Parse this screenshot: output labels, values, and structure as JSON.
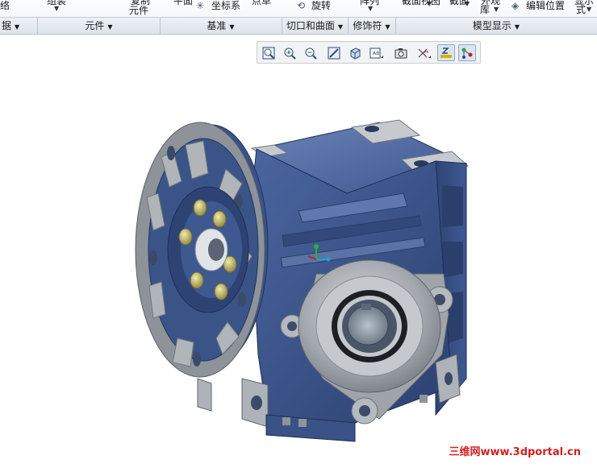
{
  "ribbon": {
    "cut_labels": [
      "组合",
      "组装",
      "元件",
      "平面",
      "坐标系",
      "基准",
      "旋转",
      "阵列",
      "截面视图",
      "截面",
      "库",
      "编辑位置",
      "显示样式"
    ],
    "partial": {
      "p0": "",
      "p1": "",
      "p2": "元件",
      "p3": "坐标系",
      "p4": "",
      "p5": "旋转",
      "p6": "",
      "p7": "库",
      "p8": "编辑位置",
      "p9": "式"
    },
    "groups": {
      "data": "据",
      "component": "元件",
      "datum": "基准",
      "cut_surface": "切口和曲面",
      "modifiers": "修饰符",
      "model_display": "模型显示"
    }
  },
  "view_toolbar": {
    "buttons": [
      {
        "name": "refit",
        "icon": "zoom-to-fit-icon",
        "active": false
      },
      {
        "name": "zoom-in",
        "icon": "zoom-in-icon",
        "active": false
      },
      {
        "name": "zoom-out",
        "icon": "zoom-out-icon",
        "active": false
      },
      {
        "name": "repaint",
        "icon": "repaint-icon",
        "active": false
      },
      {
        "name": "display-style",
        "icon": "display-style-icon",
        "active": false
      },
      {
        "name": "saved-orientations",
        "icon": "saved-views-icon",
        "active": false
      },
      {
        "name": "view-manager",
        "icon": "view-manager-icon",
        "active": false
      },
      {
        "name": "datum-display",
        "icon": "datum-display-icon",
        "active": false
      },
      {
        "name": "annotation-display",
        "icon": "annotation-display-icon",
        "active": true
      },
      {
        "name": "spin-center",
        "icon": "spin-center-icon",
        "active": true
      }
    ]
  },
  "model": {
    "description_icon": "worm-gear-reducer-model",
    "body_color": "#3b5488",
    "flange_color": "#8e949b",
    "bolt_color": "#c9c07a"
  },
  "watermark": "三维网www.3dportal.cn"
}
